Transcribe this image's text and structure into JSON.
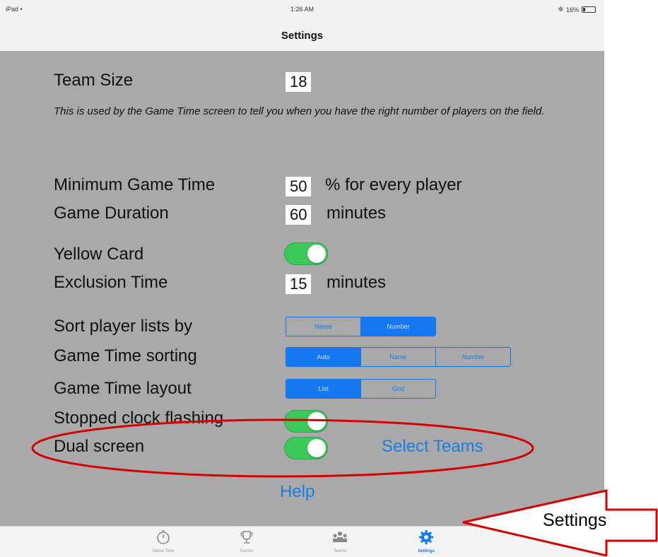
{
  "status_bar": {
    "device": "iPad",
    "time": "1:26 AM",
    "battery": "16%"
  },
  "nav": {
    "title": "Settings"
  },
  "settings": {
    "team_size": {
      "label": "Team Size",
      "value": "18",
      "description": "This is used by the Game Time screen to tell you when you have the right number of players on the field."
    },
    "min_game_time": {
      "label": "Minimum Game Time",
      "value": "50",
      "suffix": "% for every player"
    },
    "game_duration": {
      "label": "Game Duration",
      "value": "60",
      "suffix": "minutes"
    },
    "yellow_card": {
      "label": "Yellow Card",
      "on": true
    },
    "exclusion_time": {
      "label": "Exclusion Time",
      "value": "15",
      "suffix": "minutes"
    },
    "sort_players": {
      "label": "Sort player lists by",
      "options": [
        "Name",
        "Number"
      ],
      "selected": "Number"
    },
    "game_time_sorting": {
      "label": "Game Time sorting",
      "options": [
        "Auto",
        "Name",
        "Number"
      ],
      "selected": "Auto"
    },
    "game_time_layout": {
      "label": "Game Time layout",
      "options": [
        "List",
        "Grid"
      ],
      "selected": "List"
    },
    "stopped_clock": {
      "label": "Stopped clock flashing",
      "on": true
    },
    "dual_screen": {
      "label": "Dual screen",
      "on": true,
      "link": "Select Teams"
    },
    "help_link": "Help"
  },
  "tabs": [
    {
      "label": "Game Time",
      "icon": "stopwatch-icon",
      "active": false
    },
    {
      "label": "Games",
      "icon": "trophy-icon",
      "active": false
    },
    {
      "label": "Teams",
      "icon": "team-icon",
      "active": false
    },
    {
      "label": "Settings",
      "icon": "gear-icon",
      "active": true
    }
  ],
  "annotation": {
    "label": "Settings",
    "color": "#d40000"
  },
  "colors": {
    "accent": "#1478f0",
    "toggle_on": "#3cc85a",
    "panel": "#a9a9a9"
  }
}
